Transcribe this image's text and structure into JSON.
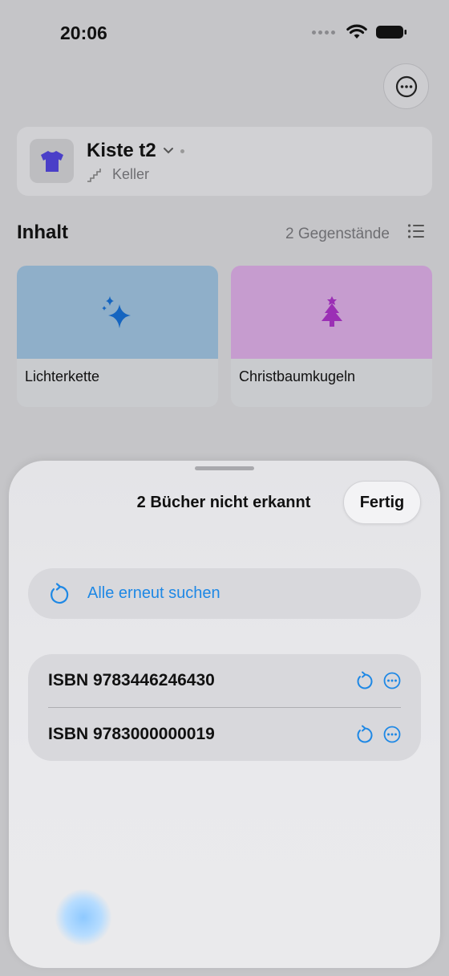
{
  "status_bar": {
    "time": "20:06"
  },
  "box": {
    "title": "Kiste t2",
    "location": "Keller"
  },
  "contents": {
    "title": "Inhalt",
    "count": "2 Gegenstände",
    "items": [
      {
        "label": "Lichterkette",
        "color": "#8fafc9",
        "icon": "sparkles-icon"
      },
      {
        "label": "Christbaumkugeln",
        "color": "#c69ccf",
        "icon": "christmas-tree-icon"
      }
    ]
  },
  "sheet": {
    "title": "2 Bücher nicht erkannt",
    "done_label": "Fertig",
    "retry_all_label": "Alle erneut suchen",
    "isbns": [
      {
        "text": "ISBN 9783446246430"
      },
      {
        "text": "ISBN 9783000000019"
      }
    ]
  },
  "colors": {
    "accent": "#1e88e5"
  }
}
